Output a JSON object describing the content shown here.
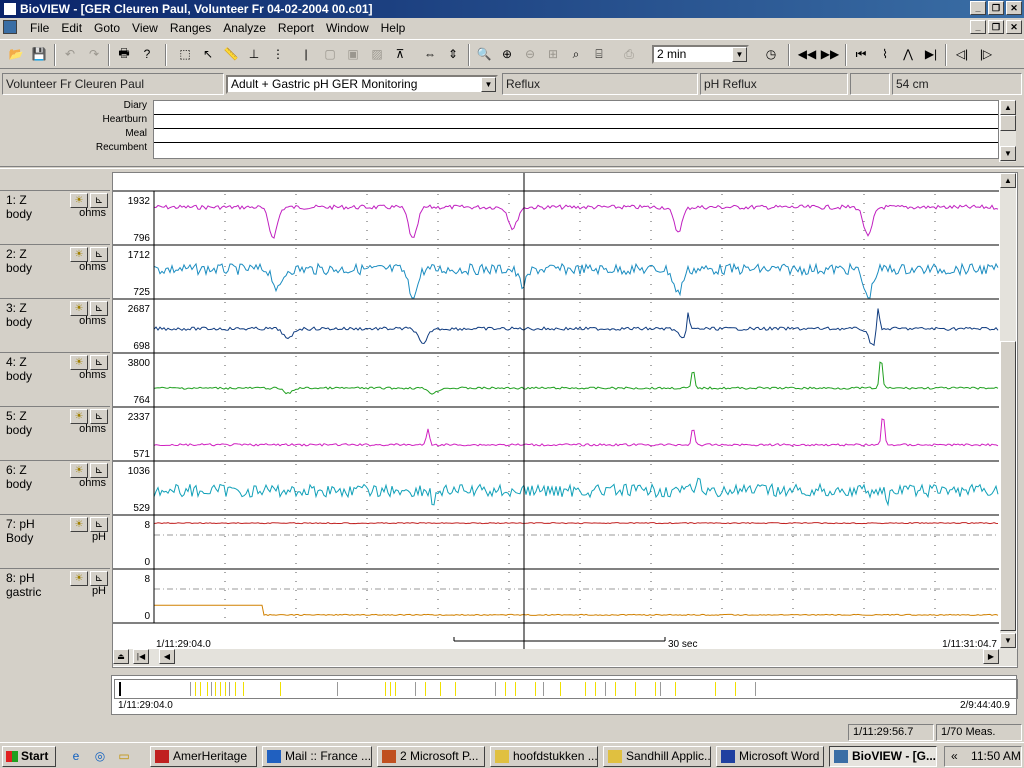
{
  "window": {
    "title": "BioVIEW - [GER Cleuren Paul, Volunteer Fr 04-02-2004 00.c01]",
    "buttons": [
      "_",
      "❐",
      "✕"
    ]
  },
  "menu": [
    "File",
    "Edit",
    "Goto",
    "View",
    "Ranges",
    "Analyze",
    "Report",
    "Window",
    "Help"
  ],
  "toolbar": {
    "time_scale": "2 min"
  },
  "info": {
    "patient": "Volunteer Fr Cleuren Paul",
    "protocol": "Adult + Gastric pH GER Monitoring",
    "diagnosis": "Reflux",
    "study": "pH Reflux",
    "blank": "",
    "length": "54 cm"
  },
  "events": [
    "Diary",
    "Heartburn",
    "Meal",
    "Recumbent"
  ],
  "channels": [
    {
      "name": "1: Z",
      "site": "body",
      "unit": "ohms",
      "max": "1932",
      "min": "796",
      "color": "#c020c0"
    },
    {
      "name": "2: Z",
      "site": "body",
      "unit": "ohms",
      "max": "1712",
      "min": "725",
      "color": "#1a8cc0"
    },
    {
      "name": "3: Z",
      "site": "body",
      "unit": "ohms",
      "max": "2687",
      "min": "698",
      "color": "#103c80"
    },
    {
      "name": "4: Z",
      "site": "body",
      "unit": "ohms",
      "max": "3800",
      "min": "764",
      "color": "#20a020"
    },
    {
      "name": "5: Z",
      "site": "body",
      "unit": "ohms",
      "max": "2337",
      "min": "571",
      "color": "#d020c0"
    },
    {
      "name": "6: Z",
      "site": "body",
      "unit": "ohms",
      "max": "1036",
      "min": "529",
      "color": "#10a0b8"
    },
    {
      "name": "7: pH",
      "site": "Body",
      "unit": "pH",
      "max": "8",
      "min": "0",
      "color": "#c02020"
    },
    {
      "name": "8: pH",
      "site": "gastric",
      "unit": "pH",
      "max": "8",
      "min": "0",
      "color": "#d08000"
    }
  ],
  "plot": {
    "start_time": "1/11:29:04.0",
    "scale_label": "30 sec",
    "end_time": "1/11:31:04.7"
  },
  "overview": {
    "start_time": "1/11:29:04.0",
    "end_time": "2/9:44:40.9"
  },
  "status": {
    "cursor_time": "1/11:29:56.7",
    "measurement": "1/70 Meas."
  },
  "taskbar": {
    "start": "Start",
    "tasks": [
      "AmerHeritage",
      "Mail :: France ...",
      "2 Microsoft P...",
      "hoofdstukken ...",
      "Sandhill Applic...",
      "Microsoft Word",
      "BioVIEW - [G..."
    ],
    "clock": "11:50 AM",
    "tray_arrow": "«"
  }
}
